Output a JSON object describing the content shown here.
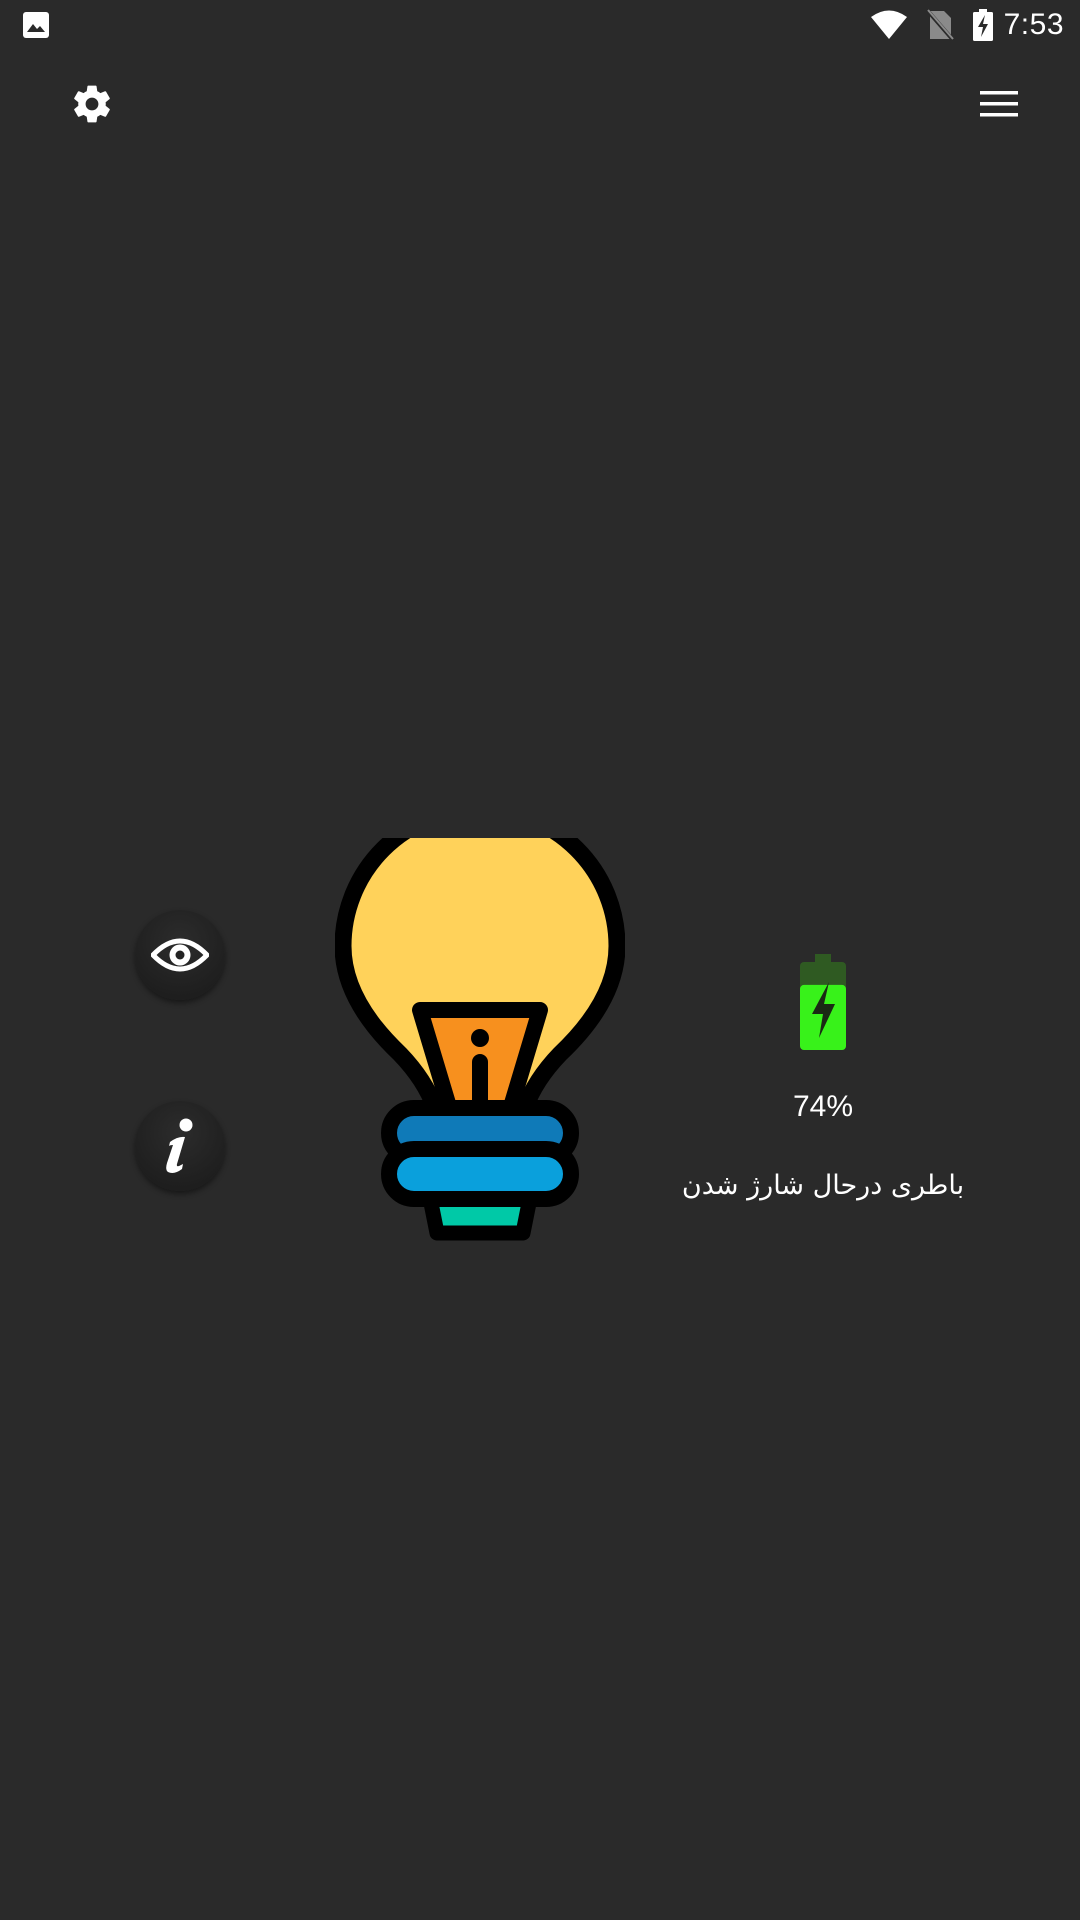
{
  "status_bar": {
    "time": "7:53",
    "icons": [
      "gallery-notification-icon",
      "wifi-icon",
      "no-sim-icon",
      "battery-charging-icon"
    ]
  },
  "app_bar": {
    "left_icon": "gear-icon",
    "right_icon": "hamburger-menu-icon"
  },
  "side_buttons": [
    {
      "icon": "eye-icon"
    },
    {
      "icon": "info-icon"
    }
  ],
  "main_illustration": {
    "icon": "light-bulb-icon",
    "colors": {
      "glass": "#ffd25a",
      "filament": "#f7901e",
      "band_top": "#0f7ab8",
      "band_bottom": "#0aa0dc",
      "tip": "#00c9a7"
    }
  },
  "battery": {
    "icon": "battery-charging-icon",
    "level_percent": 74,
    "percent_text": "74%",
    "status_text": "باطری درحال شارژ شدن",
    "colors": {
      "fill": "#38f21a",
      "top": "#2f5a22"
    }
  }
}
